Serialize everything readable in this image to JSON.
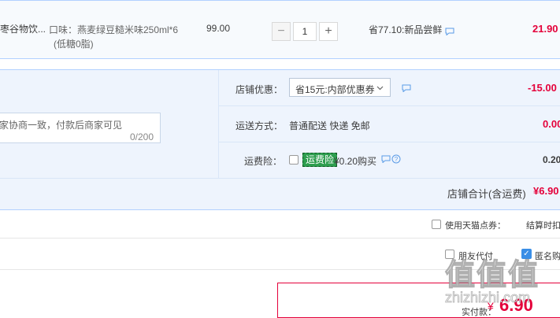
{
  "item": {
    "shop_name_partial": "枣谷物饮...",
    "spec_line1": "口味：燕麦绿豆糙米味250ml*6",
    "spec_line2": "(低糖0脂)",
    "unit_price": "99.00",
    "quantity": "1",
    "minus": "−",
    "plus": "+",
    "promo": "省77.10:新品尝鲜",
    "subtotal": "21.90"
  },
  "order": {
    "memo_placeholder": "家协商一致，付款后商家可见",
    "memo_counter": "0/200",
    "shop_discount_label": "店铺优惠：",
    "shop_discount_select": "省15元:内部优惠券",
    "shop_discount_amount": "-15.00",
    "shipping_label": "运送方式：",
    "shipping_value": "普通配送 快递 免邮",
    "shipping_amount": "0.00",
    "insurance_label": "运费险：",
    "insurance_tag": "运费险",
    "insurance_value": "¥0.20购买",
    "insurance_amount": "0.20",
    "shop_total_label": "店铺合计(含运费)",
    "shop_total_value": "¥6.90"
  },
  "options": {
    "tmall_points_label": "使用天猫点券：",
    "settle_note": "结算时扣",
    "pay_for_friend_label": "朋友代付",
    "anonymous_label": "匿名购"
  },
  "payment": {
    "actual_label": "实付款：",
    "currency": "¥",
    "amount": "6.90"
  },
  "watermark": {
    "logo": "值",
    "url": "zhizhizhi.com"
  },
  "colors": {
    "accent_red": "#e4003a",
    "border_blue": "#b2d1ff",
    "panel_bg": "#eef4fd",
    "insurance_green": "#2e9e4f",
    "checkbox_blue": "#3a8ee6"
  }
}
